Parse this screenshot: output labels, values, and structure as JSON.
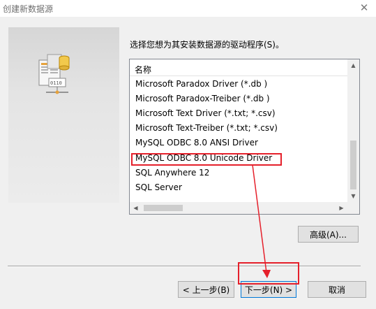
{
  "window": {
    "title": "创建新数据源",
    "close_glyph": "✕"
  },
  "prompt": "选择您想为其安装数据源的驱动程序(S)。",
  "list": {
    "header": "名称",
    "items": [
      "Microsoft Paradox Driver (*.db )",
      "Microsoft Paradox-Treiber (*.db )",
      "Microsoft Text Driver (*.txt; *.csv)",
      "Microsoft Text-Treiber (*.txt; *.csv)",
      "MySQL ODBC 8.0 ANSI Driver",
      "MySQL ODBC 8.0 Unicode Driver",
      "SQL Anywhere 12",
      "SQL Server"
    ],
    "selected": "MySQL ODBC 8.0 Unicode Driver"
  },
  "buttons": {
    "advanced": "高级(A)...",
    "back": "< 上一步(B)",
    "next": "下一步(N) >",
    "cancel": "取消"
  },
  "icon": {
    "name": "data-source-icon",
    "label_text": "0110"
  },
  "colors": {
    "annotation": "#e5202b",
    "dialog_bg": "#f0f0f0",
    "default_button_border": "#0078d7"
  }
}
